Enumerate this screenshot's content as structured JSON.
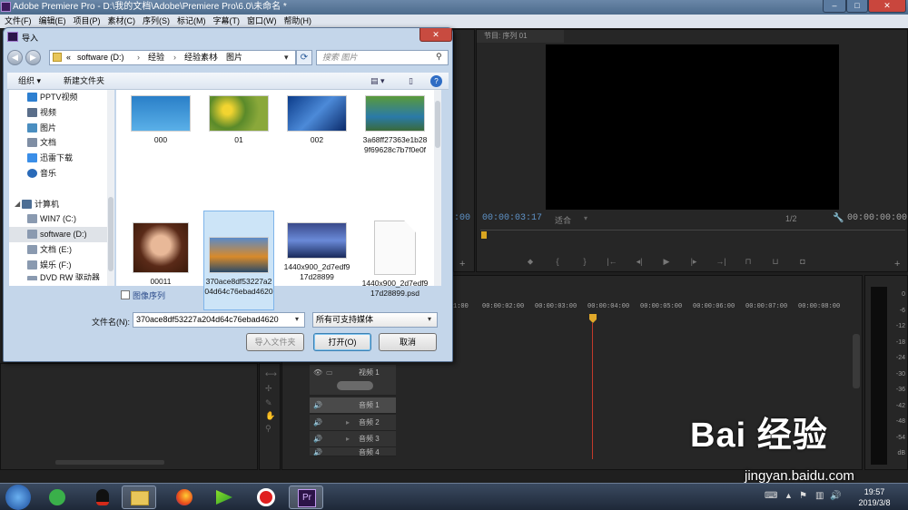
{
  "app": {
    "title": "Adobe Premiere Pro - D:\\我的文档\\Adobe\\Premiere Pro\\6.0\\未命名 *",
    "menu": [
      "文件(F)",
      "编辑(E)",
      "项目(P)",
      "素材(C)",
      "序列(S)",
      "标记(M)",
      "字幕(T)",
      "窗口(W)",
      "帮助(H)"
    ],
    "window_buttons": [
      "–",
      "□",
      "✕"
    ]
  },
  "program_monitor": {
    "tab": "节目: 序列 01",
    "timecode_left": "00:00:03:17",
    "fit": "适合",
    "ratio": "1/2",
    "timecode_right": "00:00:00:00",
    "source_timecode": ":00"
  },
  "timeline": {
    "ruler": [
      "1:00",
      "00:00:02:00",
      "00:00:03:00",
      "00:00:04:00",
      "00:00:05:00",
      "00:00:06:00",
      "00:00:07:00",
      "00:00:08:00"
    ],
    "tracks": [
      {
        "name": "视频 1",
        "kind": "video"
      },
      {
        "name": "音频 1",
        "kind": "audio"
      },
      {
        "name": "音频 2",
        "kind": "audio"
      },
      {
        "name": "音频 3",
        "kind": "audio"
      },
      {
        "name": "音频 4",
        "kind": "audio"
      }
    ],
    "meter_labels": [
      "0",
      "-6",
      "-12",
      "-18",
      "-24",
      "-30",
      "-36",
      "-42",
      "-48",
      "-54",
      "dB"
    ]
  },
  "dialog": {
    "title": "导入",
    "address": [
      "«",
      "software (D:)",
      "›",
      "经验",
      "›",
      "经验素材",
      "›",
      "图片"
    ],
    "search_placeholder": "搜索 图片",
    "organize": "组织 ▾",
    "new_folder": "新建文件夹",
    "nav": [
      {
        "label": "PPTV视频",
        "color": "#2d7fd0"
      },
      {
        "label": "视频",
        "color": "#5a6e8a"
      },
      {
        "label": "图片",
        "color": "#4a8ec0"
      },
      {
        "label": "文档",
        "color": "#7f8ea4"
      },
      {
        "label": "迅雷下载",
        "color": "#3a8ee8"
      },
      {
        "label": "音乐",
        "color": "#2a6ab8"
      },
      {
        "label": "",
        "color": ""
      },
      {
        "label": "计算机",
        "color": "#4d6e94"
      },
      {
        "label": "WIN7 (C:)",
        "color": "#8a9ab0"
      },
      {
        "label": "software (D:)",
        "color": "#8a9ab0"
      },
      {
        "label": "文档 (E:)",
        "color": "#8a9ab0"
      },
      {
        "label": "娱乐 (F:)",
        "color": "#8a9ab0"
      },
      {
        "label": "DVD RW 驱动器",
        "color": "#8a9ab0"
      }
    ],
    "files": [
      {
        "name": "000",
        "thumb": "blue-sky-figure"
      },
      {
        "name": "01",
        "thumb": "yellow-flowers"
      },
      {
        "name": "002",
        "thumb": "fish"
      },
      {
        "name": "3a68ff27363e1b289f69628c7b7f0e0f",
        "thumb": "green-landscape"
      },
      {
        "name": "00011",
        "thumb": "girl-portrait"
      },
      {
        "name": "370ace8df53227a204d64c76ebad4620",
        "thumb": "autumn-lake"
      },
      {
        "name": "1440x900_2d7edf917d28899",
        "thumb": "blue-sunset"
      },
      {
        "name": "1440x900_2d7edf917d28899.psd",
        "thumb": "blank-document"
      }
    ],
    "image_sequence_label": "图像序列",
    "filename_label": "文件名(N):",
    "filename_value": "370ace8df53227a204d64c76ebad4620",
    "filetype": "所有可支持媒体",
    "import_folder": "导入文件夹",
    "open": "打开(O)",
    "cancel": "取消"
  },
  "taskbar": {
    "time": "19:57",
    "date": "2019/3/8"
  },
  "watermark": {
    "brand": "Bai 经验",
    "url": "jingyan.baidu.com"
  }
}
